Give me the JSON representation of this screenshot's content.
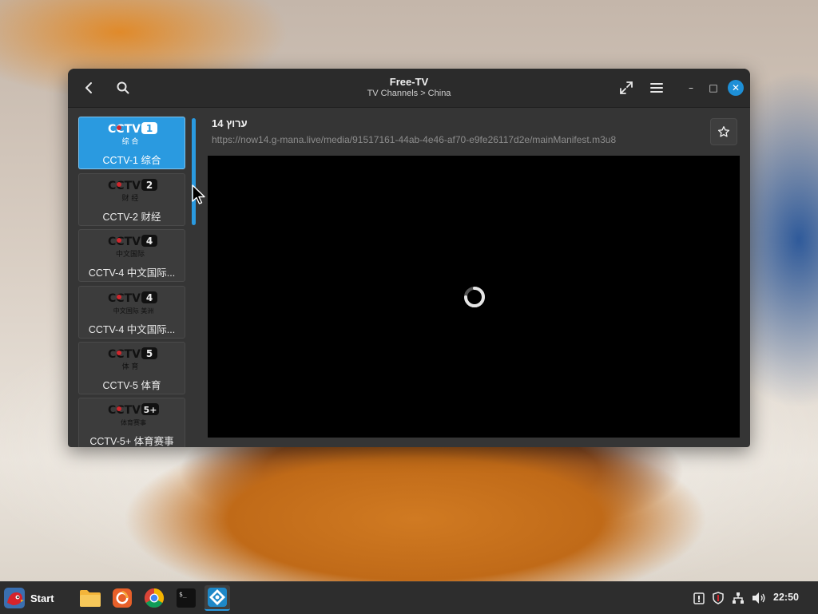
{
  "window": {
    "title": "Free-TV",
    "subtitle": "TV Channels > China",
    "controls": {
      "minimize": "–",
      "maximize": "□",
      "close": "✕"
    }
  },
  "sidebar": {
    "channels": [
      {
        "name": "CCTV-1 综合",
        "logo_num": "1",
        "logo_sub": "综 合",
        "selected": true
      },
      {
        "name": "CCTV-2 财经",
        "logo_num": "2",
        "logo_sub": "财 经",
        "selected": false
      },
      {
        "name": "CCTV-4 中文国际...",
        "logo_num": "4",
        "logo_sub": "中文国际",
        "selected": false
      },
      {
        "name": "CCTV-4 中文国际...",
        "logo_num": "4",
        "logo_sub": "中文国际 美洲",
        "selected": false
      },
      {
        "name": "CCTV-5 体育",
        "logo_num": "5",
        "logo_sub": "体 育",
        "selected": false
      },
      {
        "name": "CCTV-5+ 体育赛事",
        "logo_num": "5+",
        "logo_sub": "体育赛事",
        "selected": false
      }
    ]
  },
  "player": {
    "channel_title": "ערוץ 14",
    "stream_url": "https://now14.g-mana.live/media/91517161-44ab-4e46-af70-e9fe26117d2e/mainManifest.m3u8",
    "favorite_icon": "star-icon"
  },
  "taskbar": {
    "start_label": "Start",
    "clock": "22:50",
    "apps": [
      "files-icon",
      "firefox-icon",
      "chrome-icon",
      "terminal-icon",
      "freetv-icon"
    ]
  },
  "colors": {
    "accent": "#2a9ae0",
    "window_bg": "#353535",
    "headerbar_bg": "#2b2b2b",
    "taskbar_bg": "#2d2d2d"
  }
}
